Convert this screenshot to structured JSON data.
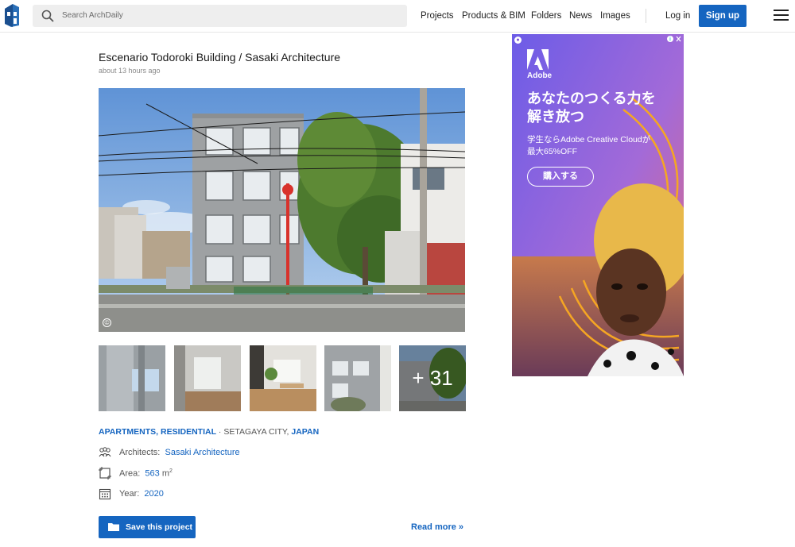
{
  "header": {
    "search_placeholder": "Search ArchDaily",
    "nav": [
      "Projects",
      "Products & BIM",
      "Folders",
      "News",
      "Images"
    ],
    "login": "Log in",
    "signup": "Sign up",
    "accent": "#1565c0"
  },
  "article": {
    "title": "Escenario Todoroki Building / Sasaki Architecture",
    "time": "about 13 hours ago",
    "photo_credit": "©",
    "thumbs_more": "+ 31",
    "categories": [
      "APARTMENTS",
      "RESIDENTIAL"
    ],
    "location_city": "SETAGAYA CITY,",
    "location_country": "JAPAN",
    "architects_label": "Architects:",
    "architects_value": "Sasaki Architecture",
    "area_label": "Area:",
    "area_value": "563",
    "area_unit": "m",
    "area_sup": "2",
    "year_label": "Year:",
    "year_value": "2020",
    "save_label": "Save this project",
    "read_more": "Read more »"
  },
  "ad": {
    "brand": "Adobe",
    "headline_1": "あなたのつくる力を",
    "headline_2": "解き放つ",
    "sub_1": "学生ならAdobe Creative Cloudが",
    "sub_2": "最大65%OFF",
    "cta": "購入する"
  },
  "icons": [
    "logo-icon",
    "search-icon",
    "menu-icon",
    "architects-icon",
    "area-icon",
    "calendar-icon",
    "folder-icon",
    "info-icon",
    "close-icon"
  ]
}
